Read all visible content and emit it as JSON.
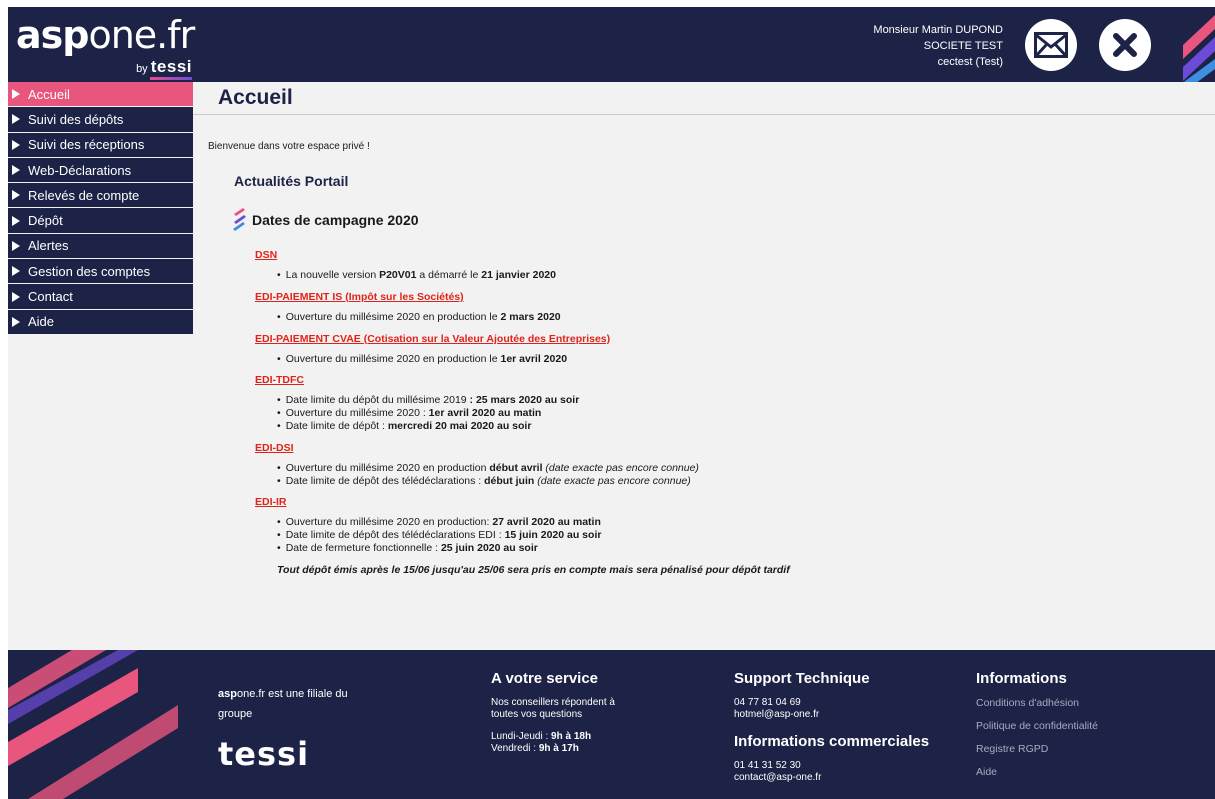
{
  "header": {
    "logo_asp": "asp",
    "logo_one": "one.fr",
    "logo_by": "by",
    "logo_tessi": "tessi",
    "user_name": "Monsieur Martin DUPOND",
    "company": "SOCIETE TEST",
    "account": "cectest (Test)",
    "mail_icon": "mail-icon",
    "close_icon": "close-icon"
  },
  "sidebar": {
    "items": [
      {
        "label": "Accueil",
        "active": true
      },
      {
        "label": "Suivi des dépôts"
      },
      {
        "label": "Suivi des réceptions"
      },
      {
        "label": "Web-Déclarations"
      },
      {
        "label": "Relevés de compte"
      },
      {
        "label": "Dépôt"
      },
      {
        "label": "Alertes"
      },
      {
        "label": "Gestion des comptes"
      },
      {
        "label": "Contact"
      },
      {
        "label": "Aide"
      }
    ]
  },
  "main": {
    "title": "Accueil",
    "welcome": "Bienvenue dans votre espace privé !",
    "news_title": "Actualités Portail",
    "campaign_title": "Dates de campagne 2020",
    "sections": [
      {
        "title": "DSN",
        "items": [
          [
            {
              "t": "La nouvelle version "
            },
            {
              "t": "P20V01",
              "b": true
            },
            {
              "t": " a démarré le "
            },
            {
              "t": "21 janvier 2020",
              "b": true
            }
          ]
        ]
      },
      {
        "title": "EDI-PAIEMENT IS (Impôt sur les Sociétés)",
        "items": [
          [
            {
              "t": "Ouverture du millésime 2020 en production le "
            },
            {
              "t": "2 mars 2020",
              "b": true
            }
          ]
        ]
      },
      {
        "title": "EDI-PAIEMENT CVAE (Cotisation sur la Valeur Ajoutée des Entreprises)",
        "items": [
          [
            {
              "t": "Ouverture du millésime 2020 en production le "
            },
            {
              "t": "1er avril 2020",
              "b": true
            }
          ]
        ]
      },
      {
        "title": "EDI-TDFC",
        "items": [
          [
            {
              "t": "Date limite du dépôt du millésime 2019 "
            },
            {
              "t": ": 25 mars 2020 au soir",
              "b": true
            }
          ],
          [
            {
              "t": "Ouverture du millésime 2020 : "
            },
            {
              "t": "1er avril 2020 au matin",
              "b": true
            }
          ],
          [
            {
              "t": "Date limite de dépôt : "
            },
            {
              "t": "mercredi 20 mai 2020 au soir",
              "b": true
            }
          ]
        ]
      },
      {
        "title": "EDI-DSI",
        "items": [
          [
            {
              "t": "Ouverture du millésime 2020 en production "
            },
            {
              "t": "début avril",
              "b": true
            },
            {
              "t": " (date exacte pas encore connue)",
              "i": true
            }
          ],
          [
            {
              "t": "Date limite de dépôt des télédéclarations : "
            },
            {
              "t": "début juin",
              "b": true
            },
            {
              "t": " (date exacte pas encore connue)",
              "i": true
            }
          ]
        ]
      },
      {
        "title": "EDI-IR",
        "items": [
          [
            {
              "t": "Ouverture du millésime 2020 en production: "
            },
            {
              "t": "27 avril 2020 au matin",
              "b": true
            }
          ],
          [
            {
              "t": "Date limite de dépôt des télédéclarations EDI : "
            },
            {
              "t": "15 juin 2020 au soir",
              "b": true
            }
          ],
          [
            {
              "t": "Date de fermeture fonctionnelle : "
            },
            {
              "t": "25 juin 2020 au soir",
              "b": true
            }
          ]
        ]
      }
    ],
    "note": "Tout dépôt émis après le 15/06 jusqu'au 25/06 sera pris en compte mais sera pénalisé pour dépôt tardif"
  },
  "footer": {
    "filiale_asp": "asp",
    "filiale_rest": "one.fr est une filiale du groupe",
    "tessi": "tessi",
    "service": {
      "heading": "A votre service",
      "text": "Nos conseillers répondent à toutes vos questions",
      "days1": "Lundi-Jeudi : ",
      "hours1": "9h à 18h",
      "days2": "Vendredi : ",
      "hours2": "9h à 17h"
    },
    "support": {
      "heading": "Support Technique",
      "phone": "04 77 81 04 69",
      "email": "hotmel@asp-one.fr",
      "commercial_heading": "Informations commerciales",
      "commercial_phone": "01 41 31 52 30",
      "commercial_email": "contact@asp-one.fr"
    },
    "info": {
      "heading": "Informations",
      "links": [
        "Conditions d'adhésion",
        "Politique de confidentialité",
        "Registre RGPD",
        "Aide"
      ]
    }
  },
  "colors": {
    "navy": "#1c2346",
    "pink": "#e8557d",
    "link_red": "#e0231a"
  }
}
